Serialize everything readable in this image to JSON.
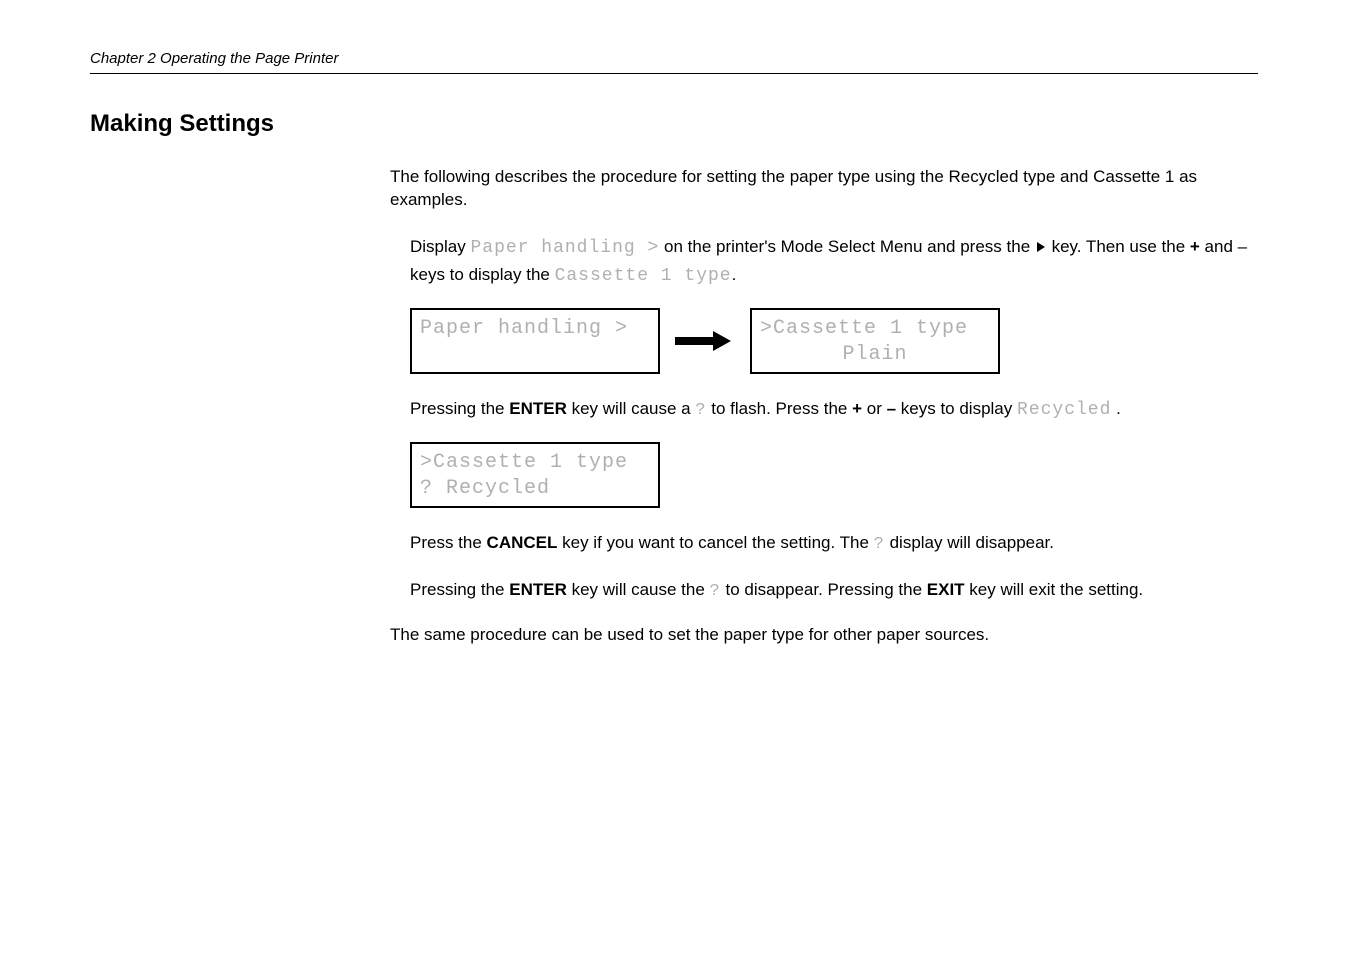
{
  "header": {
    "chapter": "Chapter 2  Operating the Page Printer"
  },
  "section": {
    "title": "Making Settings",
    "intro": "The following describes the procedure for setting the paper type using the Recycled type and Cassette 1 as examples."
  },
  "step1": {
    "pre_display": "Display ",
    "lcd_inline1": "Paper handling >",
    "mid1": " on the printer's Mode Select Menu and press the ",
    "mid2": " key. Then use the ",
    "plus": "+",
    "and": " and ",
    "minus": "–",
    "mid3": " keys to display the ",
    "lcd_inline2": "Cassette 1 type",
    "period": ".",
    "lcd_left_line1": "Paper handling >",
    "lcd_right_line1": ">Cassette 1 type",
    "lcd_right_line2": "Plain"
  },
  "step2": {
    "pre": "Pressing the ",
    "enter": "ENTER",
    "mid1": " key will cause a ",
    "qmark1": "?",
    "mid2": " to flash. Press the ",
    "plus": "+",
    "or": " or ",
    "minus": "–",
    "mid3": " keys to display ",
    "lcd_inline": "Recycled",
    "period": " .",
    "lcd_line1": ">Cassette 1 type",
    "lcd_line2": "? Recycled"
  },
  "step3": {
    "pre": "Press the ",
    "cancel": "CANCEL",
    "mid1": " key if you want to cancel the setting. The ",
    "qmark": "?",
    "mid2": " display will disappear."
  },
  "step4": {
    "pre": "Pressing the ",
    "enter": "ENTER",
    "mid1": " key will cause the ",
    "qmark": "?",
    "mid2": " to disappear. Pressing the ",
    "exit": "EXIT",
    "mid3": " key will exit the setting."
  },
  "closing": "The same procedure can be used to set the paper type for other paper sources."
}
